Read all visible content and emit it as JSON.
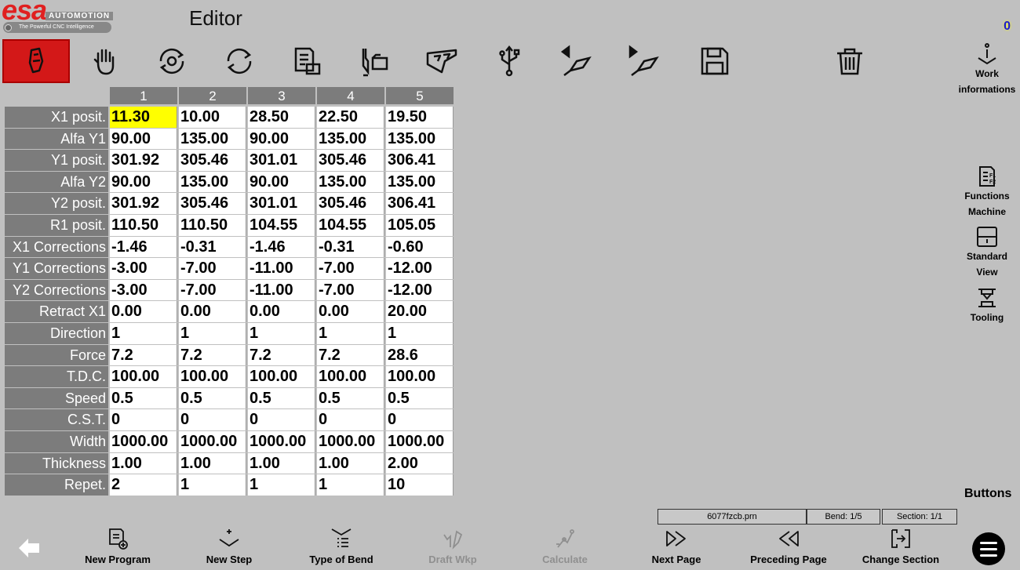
{
  "header": {
    "brand": "esa",
    "brand_suffix": "AUTOMOTION",
    "tagline": "The Powerful CNC Intelligence",
    "title": "Editor",
    "counter": "0"
  },
  "toolbar": [
    {
      "name": "edit-tool-icon",
      "active": true
    },
    {
      "name": "hand-manual-icon"
    },
    {
      "name": "tool-change-icon"
    },
    {
      "name": "refresh-cycle-icon"
    },
    {
      "name": "document-folder-icon"
    },
    {
      "name": "tool-folder-icon"
    },
    {
      "name": "bend-sequence-icon"
    },
    {
      "name": "usb-icon"
    },
    {
      "name": "previous-bend-icon"
    },
    {
      "name": "next-bend-icon"
    },
    {
      "name": "save-icon"
    },
    {
      "name": "trash-icon"
    }
  ],
  "side_panel": {
    "work_info": [
      "Work",
      "informations"
    ],
    "functions_machine": [
      "Functions",
      "Machine"
    ],
    "standard_view": [
      "Standard",
      "View"
    ],
    "tooling": "Tooling",
    "buttons": "Buttons"
  },
  "table": {
    "columns": [
      "1",
      "2",
      "3",
      "4",
      "5"
    ],
    "rows": [
      {
        "label": "X1 posit.",
        "values": [
          "11.30",
          "10.00",
          "28.50",
          "22.50",
          "19.50"
        ]
      },
      {
        "label": "Alfa Y1",
        "values": [
          "90.00",
          "135.00",
          "90.00",
          "135.00",
          "135.00"
        ]
      },
      {
        "label": "Y1 posit.",
        "values": [
          "301.92",
          "305.46",
          "301.01",
          "305.46",
          "306.41"
        ]
      },
      {
        "label": "Alfa Y2",
        "values": [
          "90.00",
          "135.00",
          "90.00",
          "135.00",
          "135.00"
        ]
      },
      {
        "label": "Y2 posit.",
        "values": [
          "301.92",
          "305.46",
          "301.01",
          "305.46",
          "306.41"
        ]
      },
      {
        "label": "R1 posit.",
        "values": [
          "110.50",
          "110.50",
          "104.55",
          "104.55",
          "105.05"
        ]
      },
      {
        "label": "X1 Corrections",
        "values": [
          "-1.46",
          "-0.31",
          "-1.46",
          "-0.31",
          "-0.60"
        ]
      },
      {
        "label": "Y1 Corrections",
        "values": [
          "-3.00",
          "-7.00",
          "-11.00",
          "-7.00",
          "-12.00"
        ]
      },
      {
        "label": "Y2 Corrections",
        "values": [
          "-3.00",
          "-7.00",
          "-11.00",
          "-7.00",
          "-12.00"
        ]
      },
      {
        "label": "Retract X1",
        "values": [
          "0.00",
          "0.00",
          "0.00",
          "0.00",
          "20.00"
        ]
      },
      {
        "label": "Direction",
        "values": [
          "1",
          "1",
          "1",
          "1",
          "1"
        ]
      },
      {
        "label": "Force",
        "values": [
          "7.2",
          "7.2",
          "7.2",
          "7.2",
          "28.6"
        ]
      },
      {
        "label": "T.D.C.",
        "values": [
          "100.00",
          "100.00",
          "100.00",
          "100.00",
          "100.00"
        ]
      },
      {
        "label": "Speed",
        "values": [
          "0.5",
          "0.5",
          "0.5",
          "0.5",
          "0.5"
        ]
      },
      {
        "label": "C.S.T.",
        "values": [
          "0",
          "0",
          "0",
          "0",
          "0"
        ]
      },
      {
        "label": "Width",
        "values": [
          "1000.00",
          "1000.00",
          "1000.00",
          "1000.00",
          "1000.00"
        ]
      },
      {
        "label": "Thickness",
        "values": [
          "1.00",
          "1.00",
          "1.00",
          "1.00",
          "2.00"
        ]
      },
      {
        "label": "Repet.",
        "values": [
          "2",
          "1",
          "1",
          "1",
          "10"
        ]
      }
    ],
    "selected": {
      "row": 0,
      "col": 0
    }
  },
  "status": {
    "file": "6077fzcb.prn",
    "bend": "Bend: 1/5",
    "section": "Section: 1/1"
  },
  "bottom": {
    "new_program": "New Program",
    "new_step": "New Step",
    "type_of_bend": "Type of Bend",
    "draft_wkp": "Draft Wkp",
    "calculate": "Calculate",
    "next_page": "Next Page",
    "preceding_page": "Preceding Page",
    "change_section": "Change Section"
  },
  "colors": {
    "background": "#c0c0c0",
    "accent_red": "#d31818",
    "selected_cell": "#ffff00",
    "header_cell": "#7c7c7c"
  }
}
